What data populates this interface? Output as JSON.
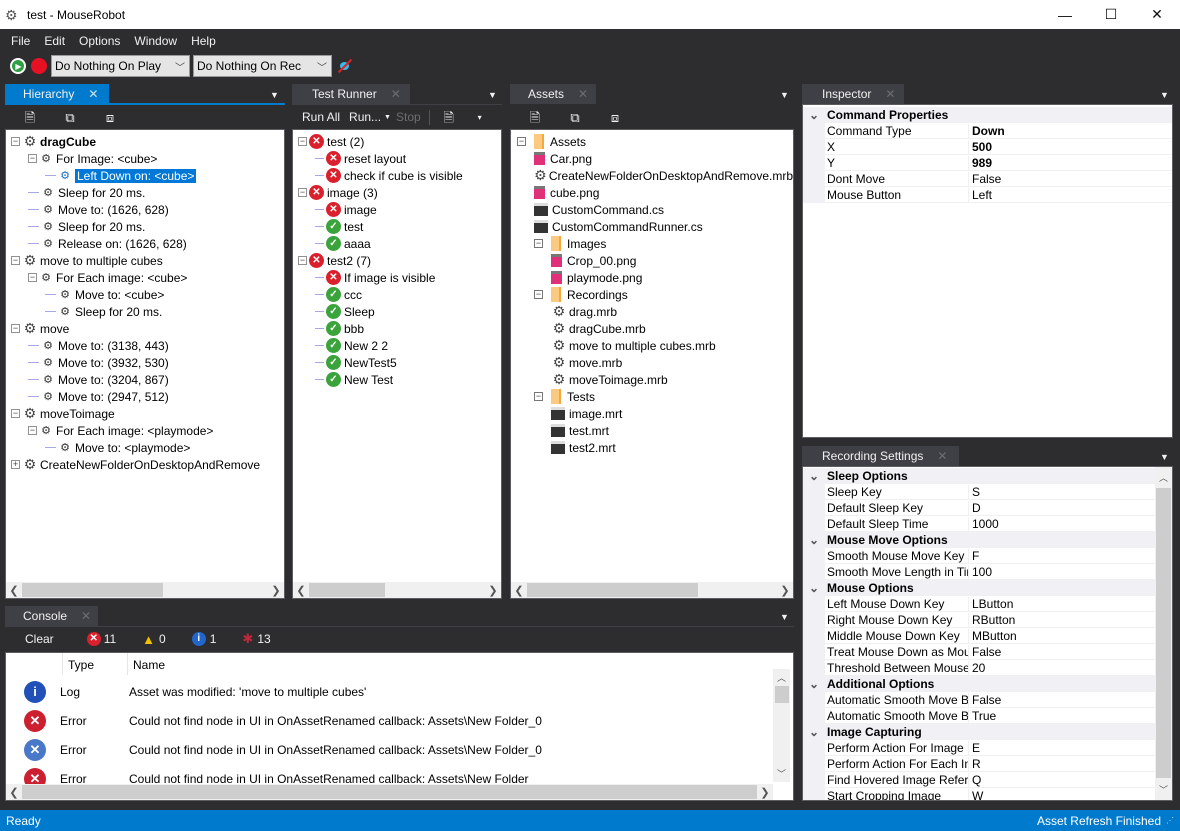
{
  "window": {
    "title": "test - MouseRobot",
    "minimize": "—",
    "maximize": "☐",
    "close": "✕"
  },
  "menu": [
    "File",
    "Edit",
    "Options",
    "Window",
    "Help"
  ],
  "toolbar": {
    "play_mode": "Do Nothing On Play",
    "rec_mode": "Do Nothing On Rec",
    "colors": {
      "play": "#2ea043",
      "record": "#e81123"
    }
  },
  "hierarchy": {
    "tab": "Hierarchy",
    "tree": [
      {
        "level": 0,
        "text": "dragCube",
        "bold": true,
        "expander": "−",
        "icon": "recording-gear-icon"
      },
      {
        "level": 1,
        "text": "For Image: <cube>",
        "expander": "−",
        "icon": "command-icon"
      },
      {
        "level": 2,
        "text": "Left Down on: <cube>",
        "selected": true,
        "icon": "command-icon"
      },
      {
        "level": 1,
        "text": "Sleep for 20 ms.",
        "icon": "command-icon"
      },
      {
        "level": 1,
        "text": "Move to: (1626, 628)",
        "icon": "command-icon"
      },
      {
        "level": 1,
        "text": "Sleep for 20 ms.",
        "icon": "command-icon"
      },
      {
        "level": 1,
        "text": "Release on: (1626, 628)",
        "icon": "command-icon"
      },
      {
        "level": 0,
        "text": "move to multiple cubes",
        "expander": "−",
        "icon": "recording-gear-icon"
      },
      {
        "level": 1,
        "text": "For Each image: <cube>",
        "expander": "−",
        "icon": "command-icon"
      },
      {
        "level": 2,
        "text": "Move to: <cube>",
        "icon": "command-icon"
      },
      {
        "level": 2,
        "text": "Sleep for 20 ms.",
        "icon": "command-icon"
      },
      {
        "level": 0,
        "text": "move",
        "expander": "−",
        "icon": "recording-gear-icon"
      },
      {
        "level": 1,
        "text": "Move to: (3138, 443)",
        "icon": "command-icon"
      },
      {
        "level": 1,
        "text": "Move to: (3932, 530)",
        "icon": "command-icon"
      },
      {
        "level": 1,
        "text": "Move to: (3204, 867)",
        "icon": "command-icon"
      },
      {
        "level": 1,
        "text": "Move to: (2947, 512)",
        "icon": "command-icon"
      },
      {
        "level": 0,
        "text": "moveToimage",
        "expander": "−",
        "icon": "recording-gear-icon"
      },
      {
        "level": 1,
        "text": "For Each image: <playmode>",
        "expander": "−",
        "icon": "command-icon"
      },
      {
        "level": 2,
        "text": "Move to: <playmode>",
        "icon": "command-icon"
      },
      {
        "level": 0,
        "text": "CreateNewFolderOnDesktopAndRemove",
        "expander": "+",
        "icon": "recording-gear-icon"
      }
    ]
  },
  "test_runner": {
    "tab": "Test Runner",
    "run_all": "Run All",
    "run": "Run...",
    "stop": "Stop",
    "tree": [
      {
        "level": 0,
        "text": "test (2)",
        "status": "fail",
        "expander": "−"
      },
      {
        "level": 1,
        "text": "reset layout",
        "status": "fail"
      },
      {
        "level": 1,
        "text": "check if cube is visible",
        "status": "fail"
      },
      {
        "level": 0,
        "text": "image (3)",
        "status": "fail",
        "expander": "−"
      },
      {
        "level": 1,
        "text": "image",
        "status": "fail"
      },
      {
        "level": 1,
        "text": "test",
        "status": "pass"
      },
      {
        "level": 1,
        "text": "aaaa",
        "status": "pass"
      },
      {
        "level": 0,
        "text": "test2 (7)",
        "status": "fail",
        "expander": "−"
      },
      {
        "level": 1,
        "text": "If image is visible",
        "status": "fail"
      },
      {
        "level": 1,
        "text": "ccc",
        "status": "pass"
      },
      {
        "level": 1,
        "text": "Sleep",
        "status": "pass"
      },
      {
        "level": 1,
        "text": "bbb",
        "status": "pass"
      },
      {
        "level": 1,
        "text": "New 2 2",
        "status": "pass"
      },
      {
        "level": 1,
        "text": "NewTest5",
        "status": "pass"
      },
      {
        "level": 1,
        "text": "New Test",
        "status": "pass"
      }
    ]
  },
  "assets": {
    "tab": "Assets",
    "tree": [
      {
        "level": 0,
        "text": "Assets",
        "type": "folder",
        "expander": "−"
      },
      {
        "level": 1,
        "text": "Car.png",
        "type": "image"
      },
      {
        "level": 1,
        "text": "CreateNewFolderOnDesktopAndRemove.mrb",
        "type": "recording"
      },
      {
        "level": 1,
        "text": "cube.png",
        "type": "image"
      },
      {
        "level": 1,
        "text": "CustomCommand.cs",
        "type": "script"
      },
      {
        "level": 1,
        "text": "CustomCommandRunner.cs",
        "type": "script"
      },
      {
        "level": 1,
        "text": "Images",
        "type": "folder",
        "expander": "−"
      },
      {
        "level": 2,
        "text": "Crop_00.png",
        "type": "image"
      },
      {
        "level": 2,
        "text": "playmode.png",
        "type": "image"
      },
      {
        "level": 1,
        "text": "Recordings",
        "type": "folder",
        "expander": "−"
      },
      {
        "level": 2,
        "text": "drag.mrb",
        "type": "recording"
      },
      {
        "level": 2,
        "text": "dragCube.mrb",
        "type": "recording"
      },
      {
        "level": 2,
        "text": "move to multiple cubes.mrb",
        "type": "recording"
      },
      {
        "level": 2,
        "text": "move.mrb",
        "type": "recording"
      },
      {
        "level": 2,
        "text": "moveToimage.mrb",
        "type": "recording"
      },
      {
        "level": 1,
        "text": "Tests",
        "type": "folder",
        "expander": "−"
      },
      {
        "level": 2,
        "text": "image.mrt",
        "type": "script"
      },
      {
        "level": 2,
        "text": "test.mrt",
        "type": "script"
      },
      {
        "level": 2,
        "text": "test2.mrt",
        "type": "script"
      }
    ]
  },
  "inspector": {
    "tab": "Inspector",
    "rows": [
      {
        "category": "Command Properties"
      },
      {
        "name": "Command Type",
        "value": "Down",
        "bold": true
      },
      {
        "name": "X",
        "value": "500",
        "bold": true
      },
      {
        "name": "Y",
        "value": "989",
        "bold": true
      },
      {
        "name": "Dont Move",
        "value": "False"
      },
      {
        "name": "Mouse Button",
        "value": "Left"
      }
    ]
  },
  "recording_settings": {
    "tab": "Recording Settings",
    "rows": [
      {
        "category": "Sleep Options"
      },
      {
        "name": "Sleep Key",
        "value": "S"
      },
      {
        "name": "Default Sleep Key",
        "value": "D"
      },
      {
        "name": "Default Sleep Time",
        "value": "1000"
      },
      {
        "category": "Mouse Move Options"
      },
      {
        "name": "Smooth Mouse Move Key",
        "value": "F"
      },
      {
        "name": "Smooth Move Length in Time",
        "value": "100"
      },
      {
        "category": "Mouse Options"
      },
      {
        "name": "Left Mouse Down Key",
        "value": "LButton"
      },
      {
        "name": "Right Mouse Down Key",
        "value": "RButton"
      },
      {
        "name": "Middle Mouse Down Key",
        "value": "MButton"
      },
      {
        "name": "Treat Mouse Down as Mouse Click",
        "value": "False"
      },
      {
        "name": "Threshold Between Mouse Down",
        "value": "20"
      },
      {
        "category": "Additional Options"
      },
      {
        "name": "Automatic Smooth Move Before Click",
        "value": "False"
      },
      {
        "name": "Automatic Smooth Move Before Down",
        "value": "True"
      },
      {
        "category": "Image Capturing"
      },
      {
        "name": "Perform Action For Image Position",
        "value": "E"
      },
      {
        "name": "Perform Action For Each Image",
        "value": "R"
      },
      {
        "name": "Find Hovered Image Reference",
        "value": "Q"
      },
      {
        "name": "Start Cropping Image",
        "value": "W"
      }
    ]
  },
  "console": {
    "tab": "Console",
    "clear": "Clear",
    "counts": {
      "errors": "11",
      "warnings": "0",
      "info": "1",
      "bugs": "13"
    },
    "columns": {
      "type": "Type",
      "name": "Name"
    },
    "rows": [
      {
        "kind": "info",
        "type": "Log",
        "message": "Asset was modified: 'move to multiple cubes'"
      },
      {
        "kind": "error",
        "type": "Error",
        "message": "Could not find node in UI in OnAssetRenamed callback: Assets\\New Folder_0"
      },
      {
        "kind": "error-selected",
        "type": "Error",
        "message": "Could not find node in UI in OnAssetRenamed callback: Assets\\New Folder_0"
      },
      {
        "kind": "error",
        "type": "Error",
        "message": "Could not find node in UI in OnAssetRenamed callback: Assets\\New Folder"
      }
    ]
  },
  "status": {
    "left": "Ready",
    "right": "Asset Refresh Finished"
  }
}
